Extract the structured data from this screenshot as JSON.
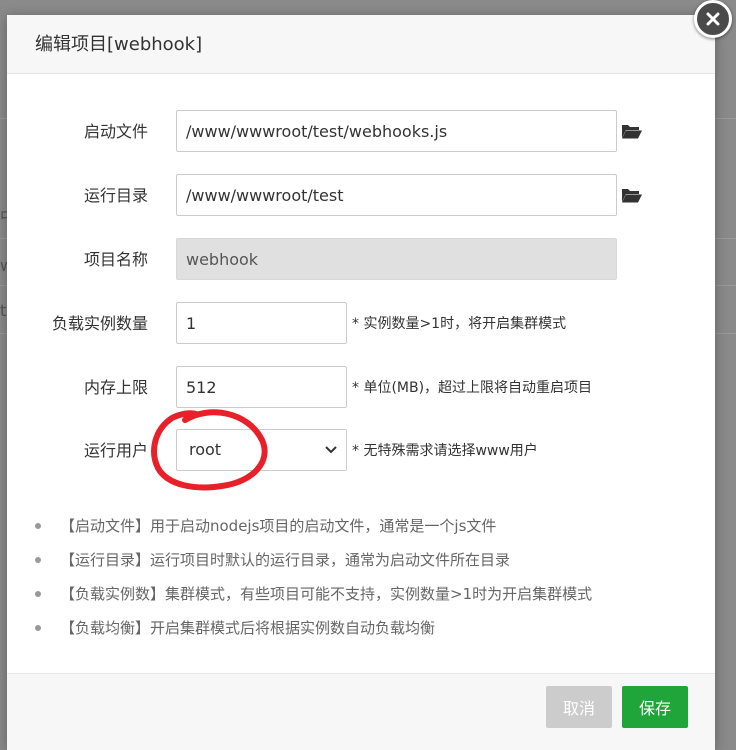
{
  "background": {
    "fragments": [
      "中",
      "w",
      "t"
    ]
  },
  "dialog": {
    "title": "编辑项目[webhook]",
    "close_icon": "close-icon"
  },
  "form": {
    "start_file": {
      "label": "启动文件",
      "value": "/www/wwwroot/test/webhooks.js",
      "icon": "folder-open-icon"
    },
    "run_dir": {
      "label": "运行目录",
      "value": "/www/wwwroot/test",
      "icon": "folder-open-icon"
    },
    "project_name": {
      "label": "项目名称",
      "value": "webhook"
    },
    "instances": {
      "label": "负载实例数量",
      "value": "1",
      "hint": "* 实例数量>1时，将开启集群模式"
    },
    "memory": {
      "label": "内存上限",
      "value": "512",
      "hint": "* 单位(MB)，超过上限将自动重启项目"
    },
    "run_user": {
      "label": "运行用户",
      "selected": "root",
      "hint": "* 无特殊需求请选择www用户"
    }
  },
  "notes": [
    "【启动文件】用于启动nodejs项目的启动文件，通常是一个js文件",
    "【运行目录】运行项目时默认的运行目录，通常为启动文件所在目录",
    "【负载实例数】集群模式，有些项目可能不支持，实例数量>1时为开启集群模式",
    "【负载均衡】开启集群模式后将根据实例数自动负载均衡"
  ],
  "footer": {
    "cancel_label": "取消",
    "save_label": "保存"
  },
  "colors": {
    "primary": "#20a53a",
    "cancel": "#cccccc",
    "annotation": "#e8202a"
  }
}
